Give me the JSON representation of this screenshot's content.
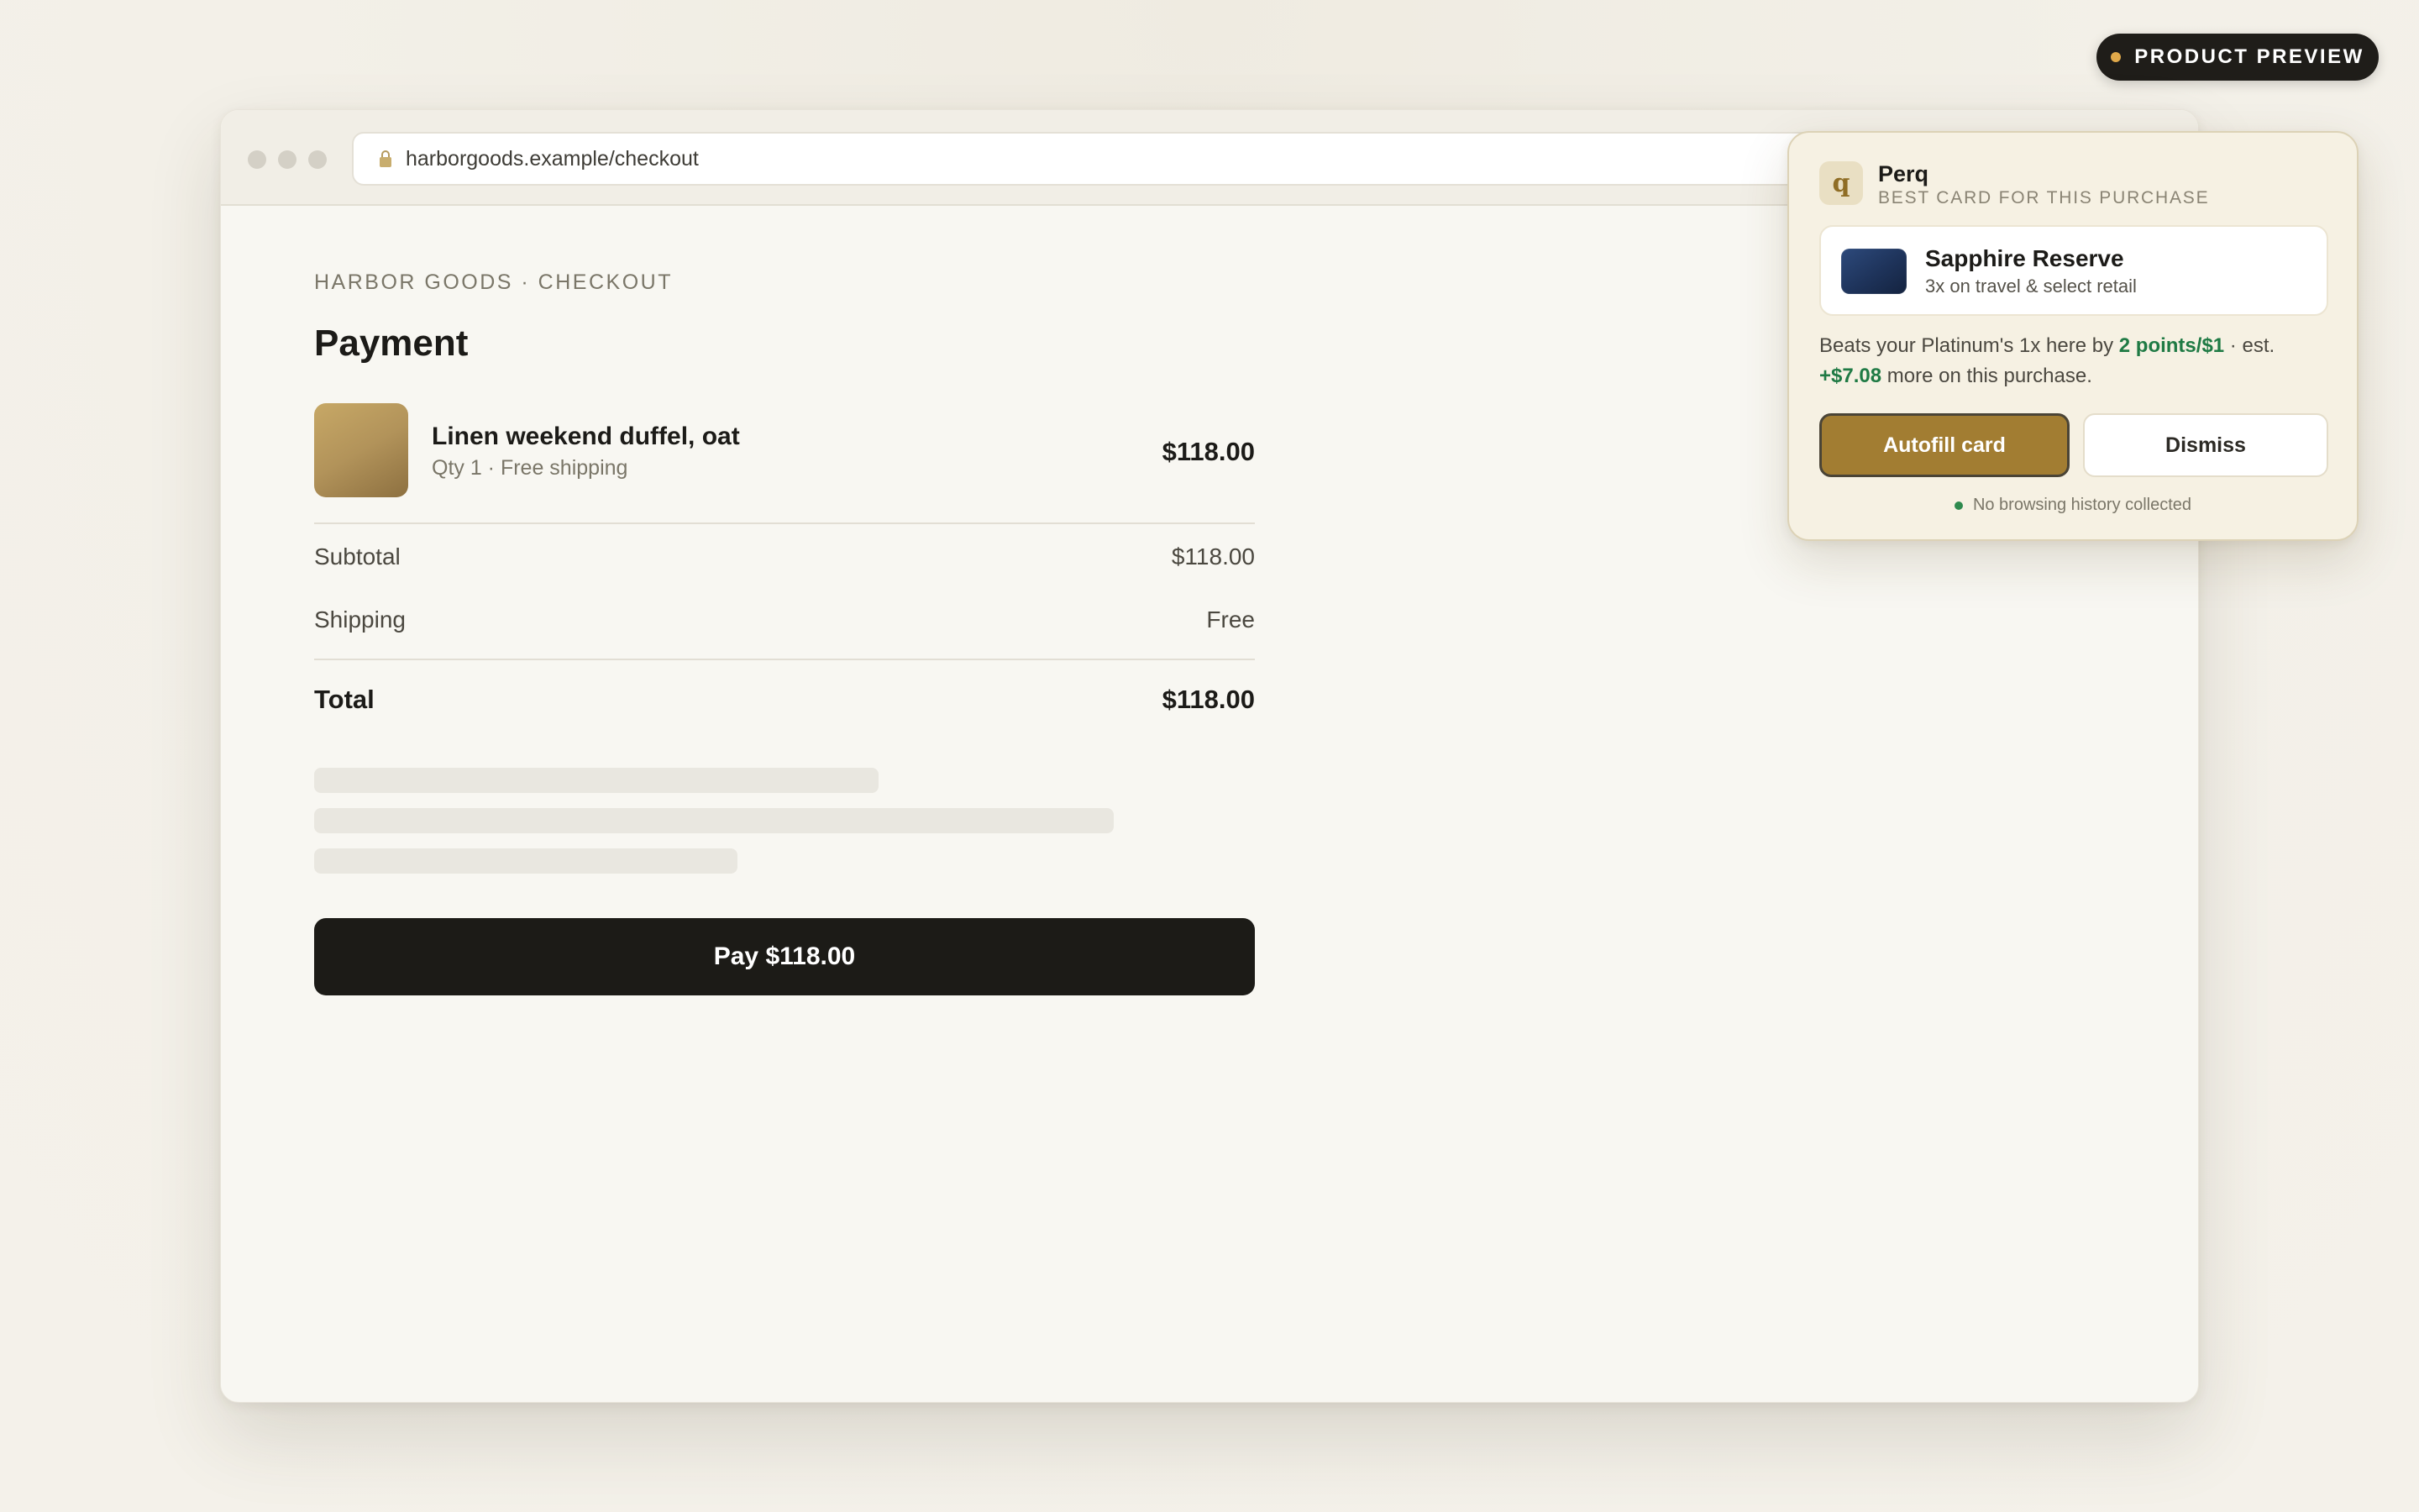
{
  "preview_badge": {
    "label": "PRODUCT PREVIEW",
    "dot_color": "#e0a94a"
  },
  "browser": {
    "url": "harborgoods.example/checkout",
    "icons": {
      "lock": "lock-icon"
    }
  },
  "checkout": {
    "brand_line": "HARBOR GOODS · CHECKOUT",
    "title": "Payment",
    "item": {
      "name": "Linen weekend duffel, oat",
      "details": "Qty 1 · Free shipping",
      "price": "$118.00"
    },
    "summary": {
      "subtotal_label": "Subtotal",
      "subtotal_value": "$118.00",
      "shipping_label": "Shipping",
      "shipping_value": "Free",
      "total_label": "Total",
      "total_value": "$118.00"
    },
    "pay_button": "Pay $118.00"
  },
  "perq": {
    "logo": "q",
    "name": "Perq",
    "tagline": "BEST CARD FOR THIS PURCHASE",
    "card": {
      "name": "Sapphire Reserve",
      "description": "3x on travel & select retail"
    },
    "comparison": {
      "prefix": "Beats your Platinum's 1x here by ",
      "points": "2 points/$1",
      "middle": " · est. ",
      "savings": "+$7.08",
      "suffix": " more on this purchase."
    },
    "autofill_button": "Autofill card",
    "dismiss_button": "Dismiss",
    "privacy_note": "No browsing history collected"
  },
  "colors": {
    "accent_gold": "#a27d32",
    "savings_green": "#1f7a44",
    "pay_button": "#1c1b17"
  }
}
